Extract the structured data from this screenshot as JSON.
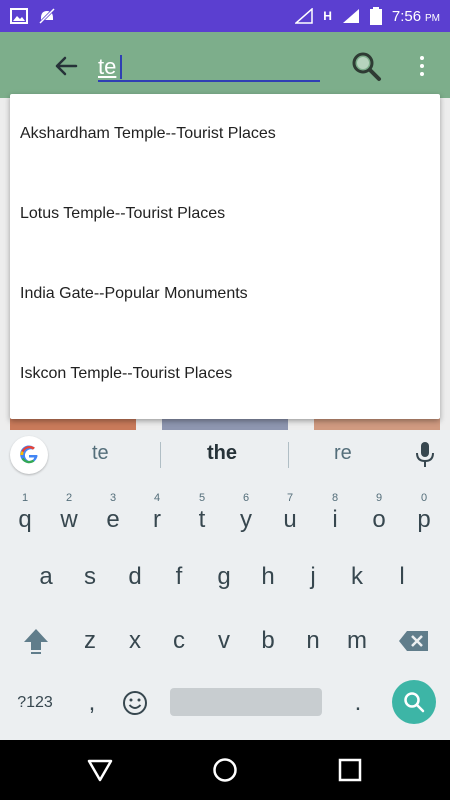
{
  "status_bar": {
    "time": "7:56",
    "ampm": "PM",
    "network": "H",
    "icons": [
      "image-icon",
      "notifications-off-icon",
      "signal-icon",
      "battery-icon"
    ]
  },
  "app_bar": {
    "search_value": "te",
    "back_icon": "arrow-left-icon",
    "search_icon": "magnifier-icon",
    "more_icon": "more-vert-icon"
  },
  "suggestions": [
    "Akshardham Temple--Tourist Places",
    "Lotus Temple--Tourist Places",
    "India Gate--Popular Monuments",
    "Iskcon Temple--Tourist Places"
  ],
  "keyboard": {
    "word_suggestions": [
      "te",
      "the",
      "re"
    ],
    "row1": [
      {
        "key": "q",
        "hint": "1"
      },
      {
        "key": "w",
        "hint": "2"
      },
      {
        "key": "e",
        "hint": "3"
      },
      {
        "key": "r",
        "hint": "4"
      },
      {
        "key": "t",
        "hint": "5"
      },
      {
        "key": "y",
        "hint": "6"
      },
      {
        "key": "u",
        "hint": "7"
      },
      {
        "key": "i",
        "hint": "8"
      },
      {
        "key": "o",
        "hint": "9"
      },
      {
        "key": "p",
        "hint": "0"
      }
    ],
    "row2": [
      "a",
      "s",
      "d",
      "f",
      "g",
      "h",
      "j",
      "k",
      "l"
    ],
    "row3": [
      "z",
      "x",
      "c",
      "v",
      "b",
      "n",
      "m"
    ],
    "symbols_label": "?123",
    "comma": ",",
    "period": "."
  },
  "colors": {
    "status_bar": "#5B3FD0",
    "app_bar": "#7DAE8B",
    "accent": "#2F3FB4",
    "enter": "#3DB5A6"
  }
}
